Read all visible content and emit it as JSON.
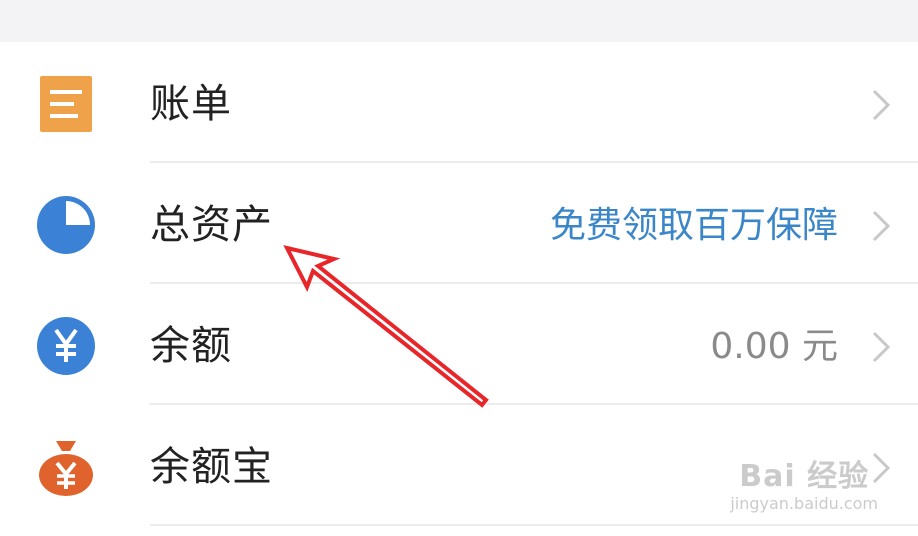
{
  "list": {
    "items": [
      {
        "label": "账单",
        "extra": "",
        "icon": "bill-icon"
      },
      {
        "label": "总资产",
        "extra": "免费领取百万保障",
        "extra_color": "#3a86c8",
        "icon": "pie-chart-icon"
      },
      {
        "label": "余额",
        "extra": "0.00 元",
        "extra_color": "#8a8a8a",
        "icon": "yuan-circle-icon"
      },
      {
        "label": "余额宝",
        "extra": "",
        "icon": "money-bag-icon"
      }
    ]
  },
  "colors": {
    "bill_icon": "#f0a24a",
    "blue_icon": "#3b82d6",
    "bag_icon": "#e0622c",
    "annotation_arrow": "#e8262a",
    "chevron": "#c8c8c8"
  },
  "watermark": {
    "main": "Bai 经验",
    "sub": "jingyan.baidu.com"
  }
}
